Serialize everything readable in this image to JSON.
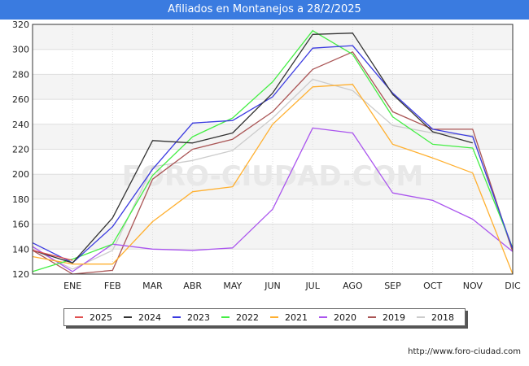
{
  "header": {
    "title": "Afiliados en Montanejos a 28/2/2025"
  },
  "watermark": "FORO-CIUDAD.COM",
  "footer": {
    "url": "http://www.foro-ciudad.com"
  },
  "chart_data": {
    "type": "line",
    "title": "Afiliados en Montanejos a 28/2/2025",
    "categories": [
      "",
      "ENE",
      "FEB",
      "MAR",
      "ABR",
      "MAY",
      "JUN",
      "JUL",
      "AGO",
      "SEP",
      "OCT",
      "NOV",
      "DIC"
    ],
    "ylim": [
      120,
      320
    ],
    "yticks": [
      120,
      140,
      160,
      180,
      200,
      220,
      240,
      260,
      280,
      300,
      320
    ],
    "grid": true,
    "legend_position": "bottom",
    "series": [
      {
        "name": "2025",
        "color": "#e05050",
        "values": [
          139,
          131,
          null,
          null,
          null,
          null,
          null,
          null,
          null,
          null,
          null,
          null,
          null
        ]
      },
      {
        "name": "2024",
        "color": "#333333",
        "values": [
          139,
          129,
          165,
          227,
          225,
          233,
          265,
          312,
          313,
          264,
          234,
          225,
          null
        ]
      },
      {
        "name": "2023",
        "color": "#3a3ae0",
        "values": [
          145,
          129,
          158,
          204,
          241,
          243,
          262,
          301,
          303,
          265,
          236,
          230,
          140
        ]
      },
      {
        "name": "2022",
        "color": "#44ee44",
        "values": [
          122,
          132,
          144,
          199,
          230,
          245,
          274,
          315,
          296,
          246,
          224,
          221,
          141
        ]
      },
      {
        "name": "2021",
        "color": "#ffb030",
        "values": [
          134,
          128,
          128,
          162,
          186,
          190,
          240,
          270,
          272,
          224,
          213,
          201,
          120
        ]
      },
      {
        "name": "2020",
        "color": "#aa55ee",
        "values": [
          142,
          122,
          144,
          140,
          139,
          141,
          172,
          237,
          233,
          185,
          179,
          164,
          138
        ]
      },
      {
        "name": "2019",
        "color": "#aa5555",
        "values": [
          139,
          120,
          123,
          196,
          220,
          228,
          250,
          284,
          298,
          250,
          236,
          236,
          138
        ]
      },
      {
        "name": "2018",
        "color": "#cccccc",
        "values": [
          140,
          124,
          139,
          206,
          211,
          219,
          245,
          276,
          267,
          239,
          233,
          231,
          138
        ]
      }
    ]
  }
}
